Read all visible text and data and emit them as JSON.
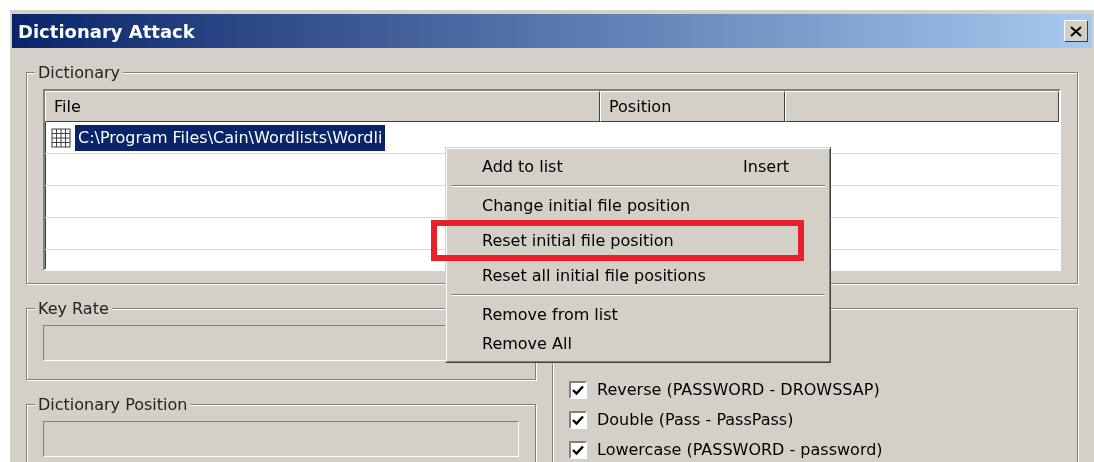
{
  "window": {
    "title": "Dictionary Attack"
  },
  "dictionary": {
    "label": "Dictionary",
    "columns": [
      "File",
      "Position"
    ],
    "rows": [
      {
        "file": "C:\\Program Files\\Cain\\Wordlists\\Wordli",
        "selected": true
      },
      {
        "file": "",
        "selected": false
      },
      {
        "file": "",
        "selected": false
      },
      {
        "file": "",
        "selected": false
      }
    ]
  },
  "key_rate": {
    "label": "Key Rate"
  },
  "dictionary_position": {
    "label": "Dictionary Position"
  },
  "options": [
    {
      "label": "Reverse (PASSWORD - DROWSSAP)",
      "checked": true
    },
    {
      "label": "Double (Pass - PassPass)",
      "checked": true
    },
    {
      "label": "Lowercase (PASSWORD - password)",
      "checked": true
    }
  ],
  "context_menu": [
    {
      "kind": "item",
      "label": "Add to list",
      "shortcut": "Insert",
      "highlighted": false
    },
    {
      "kind": "separator"
    },
    {
      "kind": "item",
      "label": "Change initial file position",
      "highlighted": false
    },
    {
      "kind": "item",
      "label": "Reset initial file position",
      "highlighted": true
    },
    {
      "kind": "item",
      "label": "Reset all initial file positions",
      "highlighted": false
    },
    {
      "kind": "separator"
    },
    {
      "kind": "item",
      "label": "Remove from list",
      "highlighted": false
    },
    {
      "kind": "item",
      "label": "Remove All",
      "highlighted": false
    }
  ]
}
